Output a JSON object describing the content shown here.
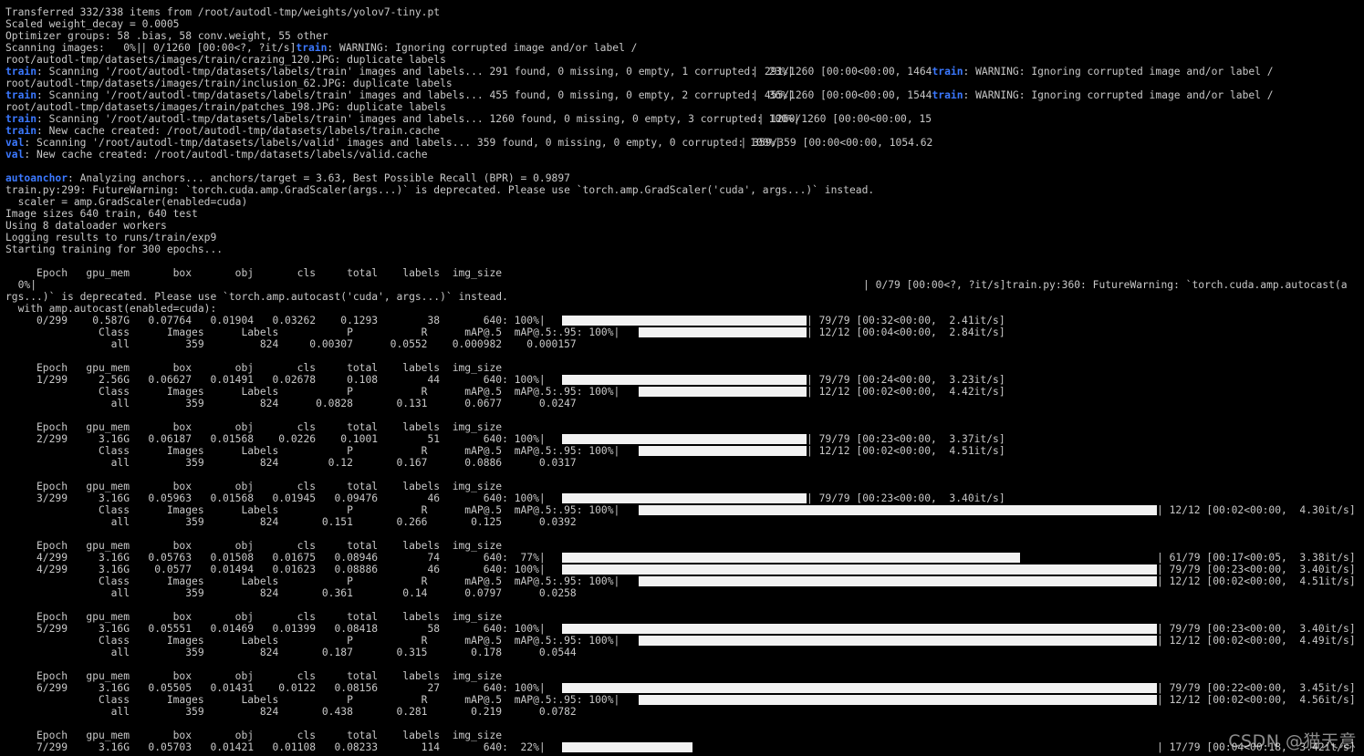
{
  "header_lines": [
    {
      "t": "Transferred 332/338 items from /root/autodl-tmp/weights/yolov7-tiny.pt"
    },
    {
      "t": "Scaled weight_decay = 0.0005"
    },
    {
      "t": "Optimizer groups: 58 .bias, 58 conv.weight, 55 other"
    },
    {
      "t": "Scanning images:   0%|",
      "right": "| 0/1260 [00:00<?, ?it/s]",
      "kw2": "train",
      "rest2": ": WARNING: Ignoring corrupted image and/or label /"
    },
    {
      "t": "root/autodl-tmp/datasets/images/train/crazing_120.JPG: duplicate labels"
    },
    {
      "kw": "train",
      "t": ": Scanning '/root/autodl-tmp/datasets/labels/train' images and labels... 291 found, 0 missing, 0 empty, 1 corrupted:  23%|",
      "right": "| 291/1260 [00:00<00:00, 1464",
      "kw2": "train",
      "rest2": ": WARNING: Ignoring corrupted image and/or label /"
    },
    {
      "t": "root/autodl-tmp/datasets/images/train/inclusion_62.JPG: duplicate labels"
    },
    {
      "kw": "train",
      "t": ": Scanning '/root/autodl-tmp/datasets/labels/train' images and labels... 455 found, 0 missing, 0 empty, 2 corrupted:  36%|",
      "right": "| 455/1260 [00:00<00:00, 1544",
      "kw2": "train",
      "rest2": ": WARNING: Ignoring corrupted image and/or label /"
    },
    {
      "t": "root/autodl-tmp/datasets/images/train/patches_198.JPG: duplicate labels"
    },
    {
      "kw": "train",
      "t": ": Scanning '/root/autodl-tmp/datasets/labels/train' images and labels... 1260 found, 0 missing, 0 empty, 3 corrupted: 100%|",
      "right": "| 1260/1260 [00:00<00:00, 15"
    },
    {
      "kw": "train",
      "t": ": New cache created: /root/autodl-tmp/datasets/labels/train.cache"
    },
    {
      "kw": "val",
      "t": ": Scanning '/root/autodl-tmp/datasets/labels/valid' images and labels... 359 found, 0 missing, 0 empty, 0 corrupted: 100%|",
      "right": "| 359/359 [00:00<00:00, 1054.62"
    },
    {
      "kw": "val",
      "t": ": New cache created: /root/autodl-tmp/datasets/labels/valid.cache"
    },
    {
      "t": ""
    },
    {
      "kw": "autoanchor",
      "t": ": Analyzing anchors... anchors/target = 3.63, Best Possible Recall (BPR) = 0.9897"
    },
    {
      "t": "train.py:299: FutureWarning: `torch.cuda.amp.GradScaler(args...)` is deprecated. Please use `torch.amp.GradScaler('cuda', args...)` instead."
    },
    {
      "t": "  scaler = amp.GradScaler(enabled=cuda)"
    },
    {
      "t": "Image sizes 640 train, 640 test"
    },
    {
      "t": "Using 8 dataloader workers"
    },
    {
      "t": "Logging results to runs/train/exp9"
    },
    {
      "t": "Starting training for 300 epochs..."
    },
    {
      "t": ""
    },
    {
      "t": "     Epoch   gpu_mem       box       obj       cls     total    labels  img_size"
    },
    {
      "t": "  0%|",
      "right": "| 0/79 [00:00<?, ?it/s]train.py:360: FutureWarning: `torch.cuda.amp.autocast(a"
    },
    {
      "t": "rgs...)` is deprecated. Please use `torch.amp.autocast('cuda', args...)` instead."
    },
    {
      "t": "  with amp.autocast(enabled=cuda):"
    }
  ],
  "epochs": [
    {
      "rows": [
        {
          "t": "     0/299    0.587G   0.07764   0.01904   0.03262    0.1293        38       640: 100%|",
          "bar": "short",
          "pct": 1.0,
          "right": "| 79/79 [00:32<00:00,  2.41it/s]"
        },
        {
          "t": "               Class      Images      Labels           P           R      mAP@.5  mAP@.5:.95: 100%|",
          "bar": "val_short",
          "pct": 1.0,
          "right": "| 12/12 [00:04<00:00,  2.84it/s]"
        },
        {
          "t": "                 all         359         824     0.00307      0.0552    0.000982    0.000157"
        }
      ]
    },
    {
      "rows": [
        {
          "t": "     Epoch   gpu_mem       box       obj       cls     total    labels  img_size"
        },
        {
          "t": "     1/299     2.56G   0.06627   0.01491   0.02678     0.108        44       640: 100%|",
          "bar": "short",
          "pct": 1.0,
          "right": "| 79/79 [00:24<00:00,  3.23it/s]"
        },
        {
          "t": "               Class      Images      Labels           P           R      mAP@.5  mAP@.5:.95: 100%|",
          "bar": "val_short",
          "pct": 1.0,
          "right": "| 12/12 [00:02<00:00,  4.42it/s]"
        },
        {
          "t": "                 all         359         824      0.0828       0.131      0.0677      0.0247"
        }
      ]
    },
    {
      "rows": [
        {
          "t": "     Epoch   gpu_mem       box       obj       cls     total    labels  img_size"
        },
        {
          "t": "     2/299     3.16G   0.06187   0.01568    0.0226    0.1001        51       640: 100%|",
          "bar": "short",
          "pct": 1.0,
          "right": "| 79/79 [00:23<00:00,  3.37it/s]"
        },
        {
          "t": "               Class      Images      Labels           P           R      mAP@.5  mAP@.5:.95: 100%|",
          "bar": "val_short",
          "pct": 1.0,
          "right": "| 12/12 [00:02<00:00,  4.51it/s]"
        },
        {
          "t": "                 all         359         824        0.12       0.167      0.0886      0.0317"
        }
      ]
    },
    {
      "rows": [
        {
          "t": "     Epoch   gpu_mem       box       obj       cls     total    labels  img_size"
        },
        {
          "t": "     3/299     3.16G   0.05963   0.01568   0.01945   0.09476        46       640: 100%|",
          "bar": "short",
          "pct": 1.0,
          "right": "| 79/79 [00:23<00:00,  3.40it/s]"
        },
        {
          "t": "               Class      Images      Labels           P           R      mAP@.5  mAP@.5:.95: 100%|",
          "bar": "val_long",
          "pct": 1.0,
          "right": "| 12/12 [00:02<00:00,  4.30it/s]"
        },
        {
          "t": "                 all         359         824       0.151       0.266       0.125      0.0392"
        }
      ]
    },
    {
      "rows": [
        {
          "t": "     Epoch   gpu_mem       box       obj       cls     total    labels  img_size"
        },
        {
          "t": "     4/299     3.16G   0.05763   0.01508   0.01675   0.08946        74       640:  77%|",
          "bar": "long",
          "pct": 0.77,
          "right": "| 61/79 [00:17<00:05,  3.38it/s]"
        },
        {
          "t": "     4/299     3.16G    0.0577   0.01494   0.01623   0.08886        46       640: 100%|",
          "bar": "long",
          "pct": 1.0,
          "right": "| 79/79 [00:23<00:00,  3.40it/s]"
        },
        {
          "t": "               Class      Images      Labels           P           R      mAP@.5  mAP@.5:.95: 100%|",
          "bar": "val_long",
          "pct": 1.0,
          "right": "| 12/12 [00:02<00:00,  4.51it/s]"
        },
        {
          "t": "                 all         359         824       0.361        0.14      0.0797      0.0258"
        }
      ]
    },
    {
      "rows": [
        {
          "t": "     Epoch   gpu_mem       box       obj       cls     total    labels  img_size"
        },
        {
          "t": "     5/299     3.16G   0.05551   0.01469   0.01399   0.08418        58       640: 100%|",
          "bar": "long",
          "pct": 1.0,
          "right": "| 79/79 [00:23<00:00,  3.40it/s]"
        },
        {
          "t": "               Class      Images      Labels           P           R      mAP@.5  mAP@.5:.95: 100%|",
          "bar": "val_long",
          "pct": 1.0,
          "right": "| 12/12 [00:02<00:00,  4.49it/s]"
        },
        {
          "t": "                 all         359         824       0.187       0.315       0.178      0.0544"
        }
      ]
    },
    {
      "rows": [
        {
          "t": "     Epoch   gpu_mem       box       obj       cls     total    labels  img_size"
        },
        {
          "t": "     6/299     3.16G   0.05505   0.01431    0.0122   0.08156        27       640: 100%|",
          "bar": "long",
          "pct": 1.0,
          "right": "| 79/79 [00:22<00:00,  3.45it/s]"
        },
        {
          "t": "               Class      Images      Labels           P           R      mAP@.5  mAP@.5:.95: 100%|",
          "bar": "val_long",
          "pct": 1.0,
          "right": "| 12/12 [00:02<00:00,  4.56it/s]"
        },
        {
          "t": "                 all         359         824       0.438       0.281       0.219      0.0782"
        }
      ]
    },
    {
      "rows": [
        {
          "t": "     Epoch   gpu_mem       box       obj       cls     total    labels  img_size"
        },
        {
          "t": "     7/299     3.16G   0.05703   0.01421   0.01108   0.08233       114       640:  22%|",
          "bar": "long",
          "pct": 0.22,
          "right": "| 17/79 [00:04<00:18,  3.42it/s]"
        }
      ]
    }
  ],
  "watermark": "CSDN @猫天意",
  "colors": {
    "keyword": "#3b78ff",
    "text": "#c8c8c8",
    "bar": "#f2f2f2",
    "background": "#000000"
  }
}
